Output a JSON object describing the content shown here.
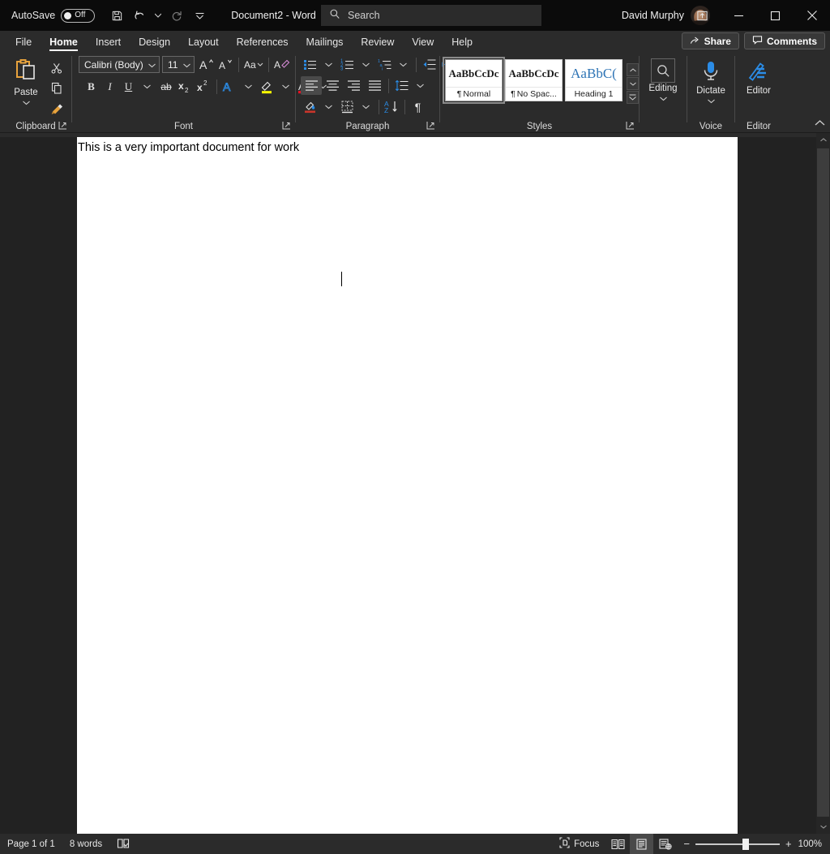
{
  "titlebar": {
    "autosave_label": "AutoSave",
    "autosave_state": "Off",
    "save_icon": "save-icon",
    "undo_icon": "undo-icon",
    "redo_icon": "redo-icon",
    "customize_qat_icon": "customize-quick-access-toolbar-icon",
    "document_title": "Document2  -  Word",
    "search_placeholder": "Search",
    "search_icon": "search-icon",
    "user_name": "David Murphy",
    "avatar": "user-avatar",
    "ribbon_display_icon": "ribbon-display-options-icon",
    "minimize_icon": "minimize-icon",
    "maximize_icon": "maximize-icon",
    "close_icon": "close-icon"
  },
  "tabs": [
    {
      "label": "File",
      "active": false
    },
    {
      "label": "Home",
      "active": true
    },
    {
      "label": "Insert",
      "active": false
    },
    {
      "label": "Design",
      "active": false
    },
    {
      "label": "Layout",
      "active": false
    },
    {
      "label": "References",
      "active": false
    },
    {
      "label": "Mailings",
      "active": false
    },
    {
      "label": "Review",
      "active": false
    },
    {
      "label": "View",
      "active": false
    },
    {
      "label": "Help",
      "active": false
    }
  ],
  "tab_actions": {
    "share_label": "Share",
    "share_icon": "share-icon",
    "comments_label": "Comments",
    "comments_icon": "comment-icon"
  },
  "ribbon": {
    "clipboard": {
      "group_label": "Clipboard",
      "paste_label": "Paste",
      "paste_icon": "paste-clipboard-icon",
      "cut_icon": "scissors-icon",
      "copy_icon": "copy-icon",
      "format_painter_icon": "format-painter-brush-icon",
      "dialog_launcher_icon": "dialog-launcher-icon"
    },
    "font": {
      "group_label": "Font",
      "font_name": "Calibri (Body)",
      "font_size": "11",
      "grow_font_icon": "grow-font-icon",
      "shrink_font_icon": "shrink-font-icon",
      "change_case_icon": "change-case-icon",
      "clear_formatting_icon": "clear-formatting-icon",
      "bold_label": "B",
      "italic_label": "I",
      "underline_label": "U",
      "strikethrough_label": "ab",
      "subscript_label": "x",
      "subscript_sub": "2",
      "superscript_label": "x",
      "superscript_sup": "2",
      "text_effects_icon": "text-effects-icon",
      "highlight_icon": "text-highlight-color-icon",
      "highlight_color": "#ffff00",
      "font_color_icon": "font-color-icon",
      "font_color": "#e81123",
      "dialog_launcher_icon": "dialog-launcher-icon"
    },
    "paragraph": {
      "group_label": "Paragraph",
      "bullets_icon": "bullets-icon",
      "numbering_icon": "numbering-icon",
      "multilevel_icon": "multilevel-list-icon",
      "decrease_indent_icon": "decrease-indent-icon",
      "increase_indent_icon": "increase-indent-icon",
      "align_left_icon": "align-left-icon",
      "align_center_icon": "align-center-icon",
      "align_right_icon": "align-right-icon",
      "justify_icon": "justify-icon",
      "line_spacing_icon": "line-spacing-icon",
      "shading_icon": "shading-icon",
      "borders_icon": "borders-icon",
      "sort_icon": "sort-icon",
      "show_marks_icon": "show-formatting-marks-icon",
      "dialog_launcher_icon": "dialog-launcher-icon"
    },
    "styles": {
      "group_label": "Styles",
      "items": [
        {
          "preview": "AaBbCcDc",
          "name": "Normal",
          "mark": "¶",
          "selected": true
        },
        {
          "preview": "AaBbCcDc",
          "name": "No Spac...",
          "mark": "¶",
          "selected": false
        },
        {
          "preview": "AaBbC(",
          "name": "Heading 1",
          "mark": "",
          "selected": false
        }
      ],
      "scroll_up_icon": "scroll-up-icon",
      "scroll_down_icon": "scroll-down-icon",
      "more_styles_icon": "more-styles-icon",
      "dialog_launcher_icon": "dialog-launcher-icon"
    },
    "editing": {
      "label": "Editing",
      "icon": "find-magnifier-icon"
    },
    "voice": {
      "group_label": "Voice",
      "dictate_label": "Dictate",
      "dictate_icon": "microphone-icon"
    },
    "editor": {
      "group_label": "Editor",
      "editor_label": "Editor",
      "editor_icon": "editor-pen-icon"
    },
    "collapse_icon": "collapse-ribbon-icon"
  },
  "document": {
    "body_text": "This is a very important document for work",
    "scroll_up_icon": "scroll-up-arrow-icon",
    "scroll_down_icon": "scroll-down-arrow-icon"
  },
  "statusbar": {
    "page_info": "Page 1 of 1",
    "word_count": "8 words",
    "proofing_icon": "proofing-errors-icon",
    "focus_label": "Focus",
    "focus_icon": "focus-mode-icon",
    "read_mode_icon": "read-mode-icon",
    "print_layout_icon": "print-layout-icon",
    "web_layout_icon": "web-layout-icon",
    "zoom_out_label": "−",
    "zoom_in_label": "+",
    "zoom_level": "100%"
  }
}
